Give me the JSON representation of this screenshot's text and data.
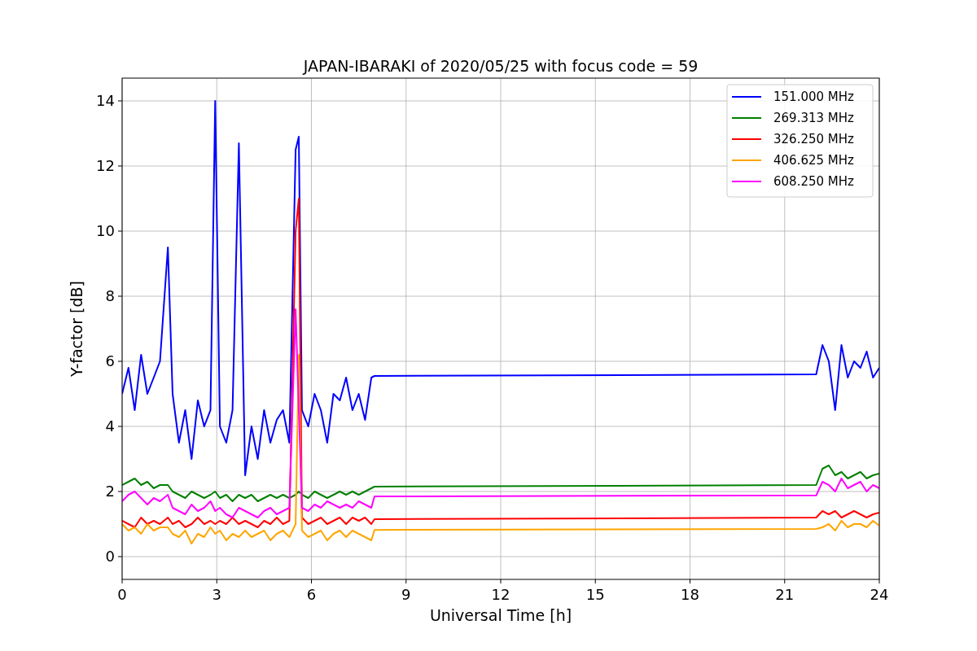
{
  "figure": {
    "chart_data": {
      "type": "line",
      "title": "JAPAN-IBARAKI of 2020/05/25 with focus code = 59",
      "xlabel": "Universal Time [h]",
      "ylabel": "Y-factor [dB]",
      "x": [
        0,
        0.2,
        0.4,
        0.6,
        0.8,
        1.0,
        1.2,
        1.45,
        1.6,
        1.8,
        2.0,
        2.2,
        2.4,
        2.6,
        2.8,
        2.95,
        3.1,
        3.3,
        3.5,
        3.7,
        3.9,
        4.1,
        4.3,
        4.5,
        4.7,
        4.9,
        5.1,
        5.3,
        5.5,
        5.6,
        5.7,
        5.9,
        6.1,
        6.3,
        6.5,
        6.7,
        6.9,
        7.1,
        7.3,
        7.5,
        7.7,
        7.9,
        8.0,
        22.0,
        22.2,
        22.4,
        22.6,
        22.8,
        23.0,
        23.2,
        23.4,
        23.6,
        23.8,
        24.0
      ],
      "series": [
        {
          "name": "151.000 MHz",
          "color": "#0000ff",
          "values": [
            5.0,
            5.8,
            4.5,
            6.2,
            5.0,
            5.5,
            6.0,
            9.5,
            5.0,
            3.5,
            4.5,
            3.0,
            4.8,
            4.0,
            4.5,
            14.0,
            4.0,
            3.5,
            4.5,
            12.7,
            2.5,
            4.0,
            3.0,
            4.5,
            3.5,
            4.2,
            4.5,
            3.5,
            12.5,
            12.9,
            4.5,
            4.0,
            5.0,
            4.5,
            3.5,
            5.0,
            4.8,
            5.5,
            4.5,
            5.0,
            4.2,
            5.5,
            5.55,
            5.6,
            6.5,
            6.0,
            4.5,
            6.5,
            5.5,
            6.0,
            5.8,
            6.3,
            5.5,
            5.8
          ]
        },
        {
          "name": "269.313 MHz",
          "color": "#008000",
          "values": [
            2.2,
            2.3,
            2.4,
            2.2,
            2.3,
            2.1,
            2.2,
            2.2,
            2.0,
            1.9,
            1.8,
            2.0,
            1.9,
            1.8,
            1.9,
            2.0,
            1.8,
            1.9,
            1.7,
            1.9,
            1.8,
            1.9,
            1.7,
            1.8,
            1.9,
            1.8,
            1.9,
            1.8,
            1.9,
            2.0,
            1.9,
            1.8,
            2.0,
            1.9,
            1.8,
            1.9,
            2.0,
            1.9,
            2.0,
            1.9,
            2.0,
            2.1,
            2.15,
            2.2,
            2.7,
            2.8,
            2.5,
            2.6,
            2.4,
            2.5,
            2.6,
            2.4,
            2.5,
            2.55
          ]
        },
        {
          "name": "326.250 MHz",
          "color": "#ff0000",
          "values": [
            1.1,
            1.0,
            0.9,
            1.2,
            1.0,
            1.1,
            1.0,
            1.2,
            1.0,
            1.1,
            0.9,
            1.0,
            1.2,
            1.0,
            1.1,
            1.0,
            1.1,
            1.0,
            1.2,
            1.0,
            1.1,
            1.0,
            0.9,
            1.1,
            1.0,
            1.2,
            1.0,
            1.1,
            10.0,
            11.0,
            1.2,
            1.0,
            1.1,
            1.2,
            1.0,
            1.1,
            1.2,
            1.0,
            1.2,
            1.1,
            1.2,
            1.0,
            1.15,
            1.2,
            1.4,
            1.3,
            1.4,
            1.2,
            1.3,
            1.4,
            1.3,
            1.2,
            1.3,
            1.35
          ]
        },
        {
          "name": "406.625 MHz",
          "color": "#ffa500",
          "values": [
            1.0,
            0.8,
            0.9,
            0.7,
            1.0,
            0.8,
            0.9,
            0.9,
            0.7,
            0.6,
            0.8,
            0.4,
            0.7,
            0.6,
            0.9,
            0.7,
            0.8,
            0.5,
            0.7,
            0.6,
            0.8,
            0.6,
            0.7,
            0.8,
            0.5,
            0.7,
            0.8,
            0.6,
            1.0,
            6.2,
            0.8,
            0.6,
            0.7,
            0.8,
            0.5,
            0.7,
            0.8,
            0.6,
            0.8,
            0.7,
            0.6,
            0.5,
            0.82,
            0.85,
            0.9,
            1.0,
            0.8,
            1.1,
            0.9,
            1.0,
            1.0,
            0.9,
            1.1,
            0.95
          ]
        },
        {
          "name": "608.250 MHz",
          "color": "#ff00ff",
          "values": [
            1.7,
            1.9,
            2.0,
            1.8,
            1.6,
            1.8,
            1.7,
            1.9,
            1.5,
            1.4,
            1.3,
            1.6,
            1.4,
            1.5,
            1.7,
            1.4,
            1.5,
            1.3,
            1.2,
            1.5,
            1.4,
            1.3,
            1.2,
            1.4,
            1.5,
            1.3,
            1.4,
            1.5,
            7.6,
            4.5,
            1.5,
            1.4,
            1.6,
            1.5,
            1.7,
            1.6,
            1.5,
            1.6,
            1.5,
            1.7,
            1.6,
            1.5,
            1.85,
            1.88,
            2.3,
            2.2,
            2.0,
            2.4,
            2.1,
            2.2,
            2.3,
            2.0,
            2.2,
            2.1
          ]
        }
      ],
      "grid": true,
      "legend": true,
      "xlim": [
        0,
        24
      ],
      "ylim": [
        -0.7,
        14.7
      ],
      "xticks": [
        0,
        3,
        6,
        9,
        12,
        15,
        18,
        21,
        24
      ],
      "yticks": [
        0,
        2,
        4,
        6,
        8,
        10,
        12,
        14
      ]
    }
  }
}
